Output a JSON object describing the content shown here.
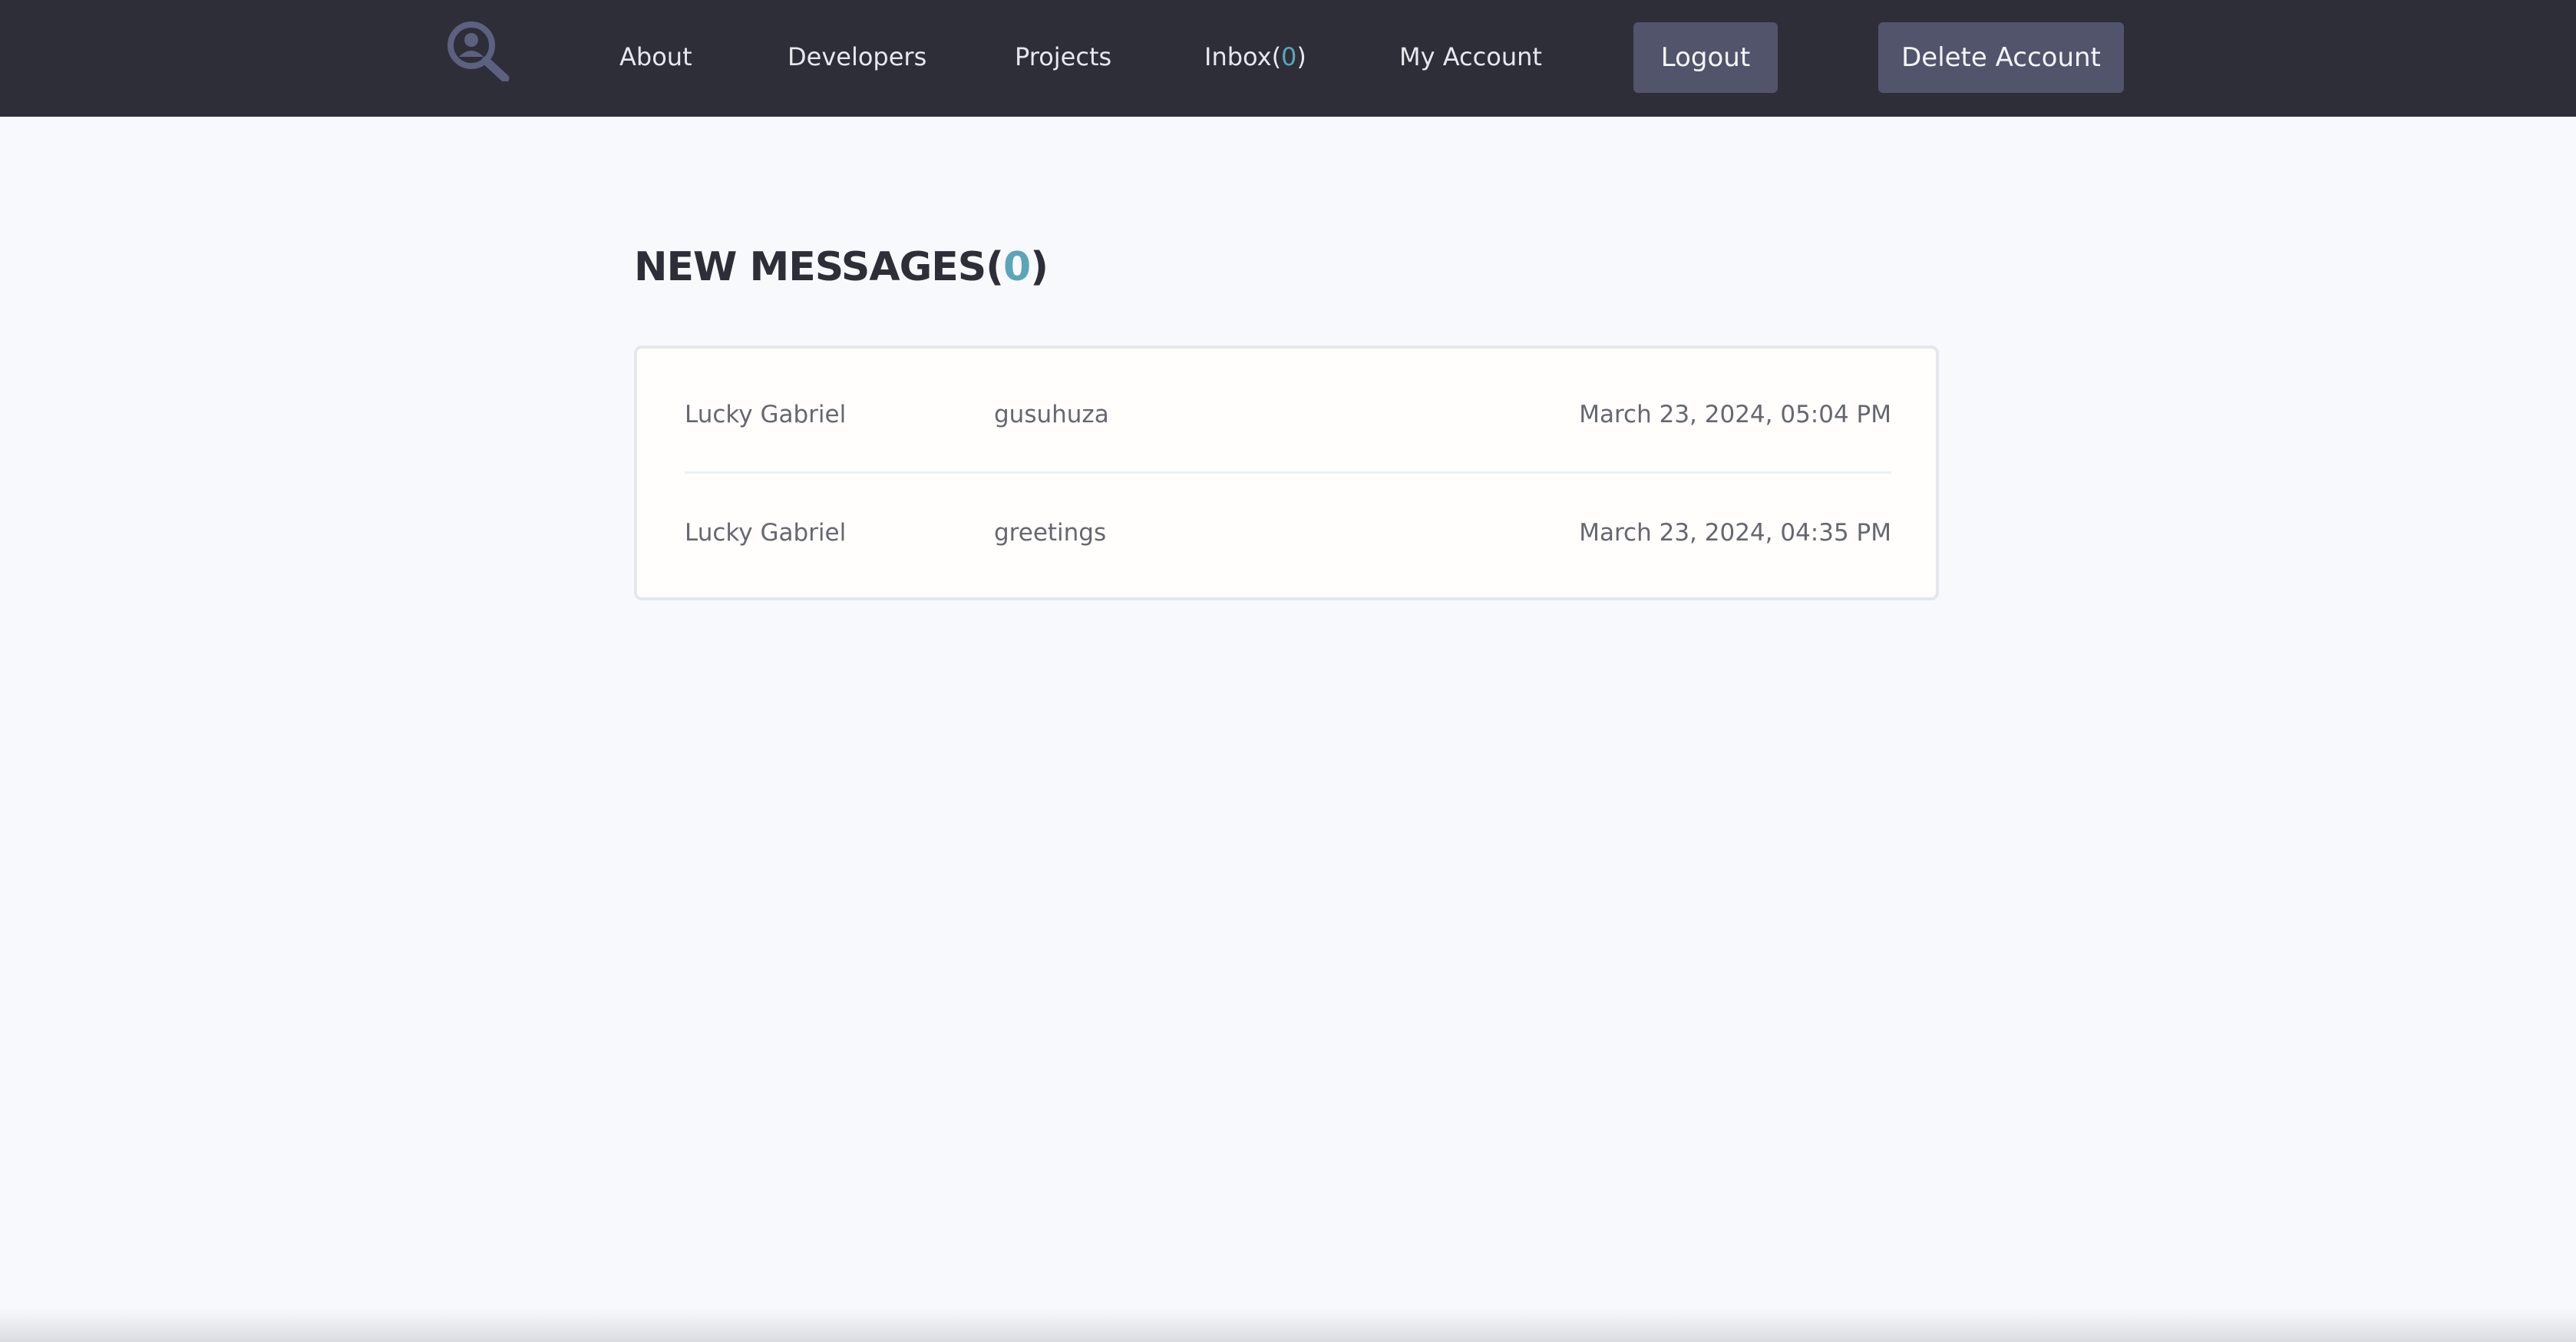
{
  "nav": {
    "logo_icon": "search-user-icon",
    "about": "About",
    "developers": "Developers",
    "projects": "Projects",
    "inbox_label": "Inbox(",
    "inbox_count": "0",
    "inbox_close": ")",
    "my_account": "My Account",
    "logout": "Logout",
    "delete_account": "Delete Account"
  },
  "page": {
    "heading_label": "NEW MESSAGES(",
    "heading_count": "0",
    "heading_close": ")"
  },
  "messages": [
    {
      "sender": "Lucky Gabriel",
      "subject": "gusuhuza",
      "date": "March 23, 2024, 05:04 PM"
    },
    {
      "sender": "Lucky Gabriel",
      "subject": "greetings",
      "date": "March 23, 2024, 04:35 PM"
    }
  ],
  "colors": {
    "nav_background": "#2d2e37",
    "button_background": "#51546b",
    "accent": "#5aa5b9",
    "page_background": "#f8f9fc"
  }
}
